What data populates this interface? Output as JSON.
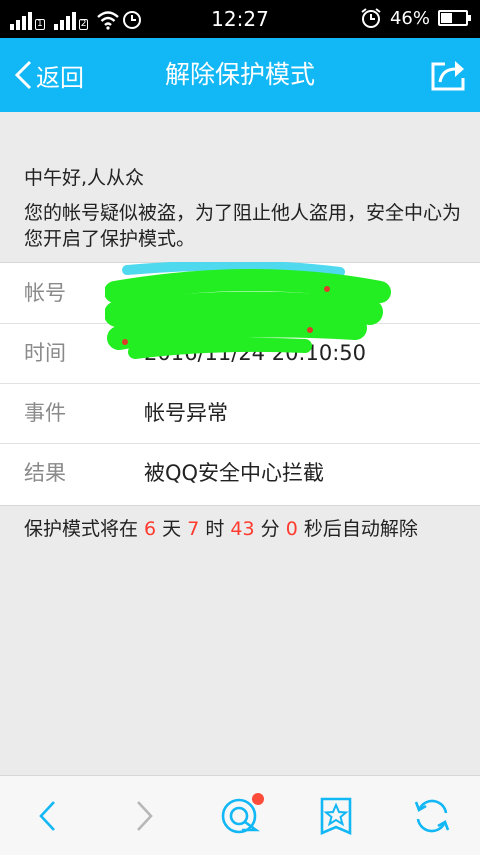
{
  "status_bar": {
    "time": "12:27",
    "battery": "46%",
    "battery_level": 0.46,
    "sim1": "1",
    "sim2": "2",
    "icons": [
      "signal-icon",
      "signal-icon",
      "wifi-icon",
      "clock-icon",
      "alarm-icon",
      "battery-icon"
    ]
  },
  "header": {
    "back_label": "返回",
    "title": "解除保护模式",
    "share_icon": "share-icon"
  },
  "greeting": "中午好,人从众",
  "notice": "您的帐号疑似被盗，为了阻止他人盗用，安全中心为您开启了保护模式。",
  "info": {
    "account": {
      "label": "帐号",
      "value": ""
    },
    "time": {
      "label": "时间",
      "value": "2016/11/24  20:10:50"
    },
    "event": {
      "label": "事件",
      "value": "帐号异常"
    },
    "result": {
      "label": "结果",
      "value": "被QQ安全中心拦截"
    }
  },
  "countdown": {
    "prefix": "保护模式将在 ",
    "days": "6",
    "days_unit": " 天 ",
    "hours": "7",
    "hours_unit": " 时 ",
    "minutes": "43",
    "minutes_unit": " 分 ",
    "seconds": "0",
    "suffix": " 秒后自动解除"
  },
  "bottom_bar": {
    "icons": [
      "back-arrow-icon",
      "forward-arrow-icon",
      "qq-browser-icon",
      "favorite-icon",
      "refresh-icon"
    ]
  },
  "colors": {
    "header": "#12b7f5",
    "countdown_number": "#ff3b30",
    "icon": "#12b7f5",
    "redaction": "#22ee22"
  }
}
